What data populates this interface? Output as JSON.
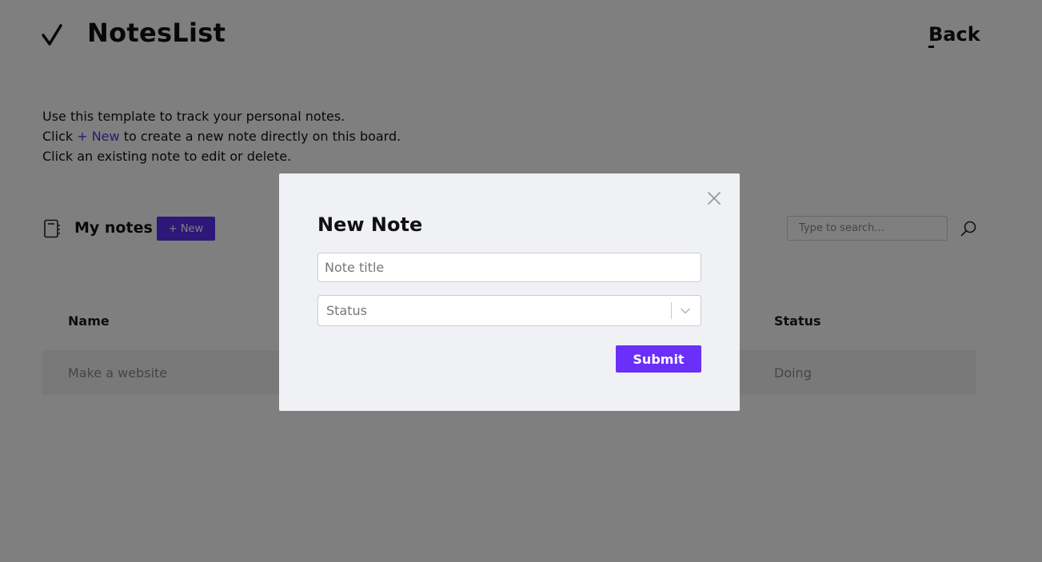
{
  "header": {
    "title": "NotesList",
    "back_label": "Back"
  },
  "intro": {
    "line1": "Use this template to track your personal notes.",
    "line2_pre": "Click ",
    "line2_link": "+ New",
    "line2_post": " to create a new note directly on this board.",
    "line3": "Click an existing note to edit or delete."
  },
  "notes_section": {
    "title": "My notes",
    "new_button_label": "+ New",
    "search_placeholder": "Type to search..."
  },
  "table": {
    "columns": [
      "Name",
      "Status"
    ],
    "rows": [
      {
        "name": "Make a website",
        "status": "Doing"
      }
    ]
  },
  "modal": {
    "title": "New Note",
    "title_placeholder": "Note title",
    "status_placeholder": "Status",
    "submit_label": "Submit"
  },
  "colors": {
    "accent": "#5a2ff0",
    "submit": "#6a2ff9",
    "overlay": "rgba(0,0,0,0.5)",
    "modal_background": "#f0f1f5"
  },
  "icons": [
    "check-icon",
    "notebook-icon",
    "search-icon",
    "close-icon",
    "chevron-down-icon"
  ]
}
